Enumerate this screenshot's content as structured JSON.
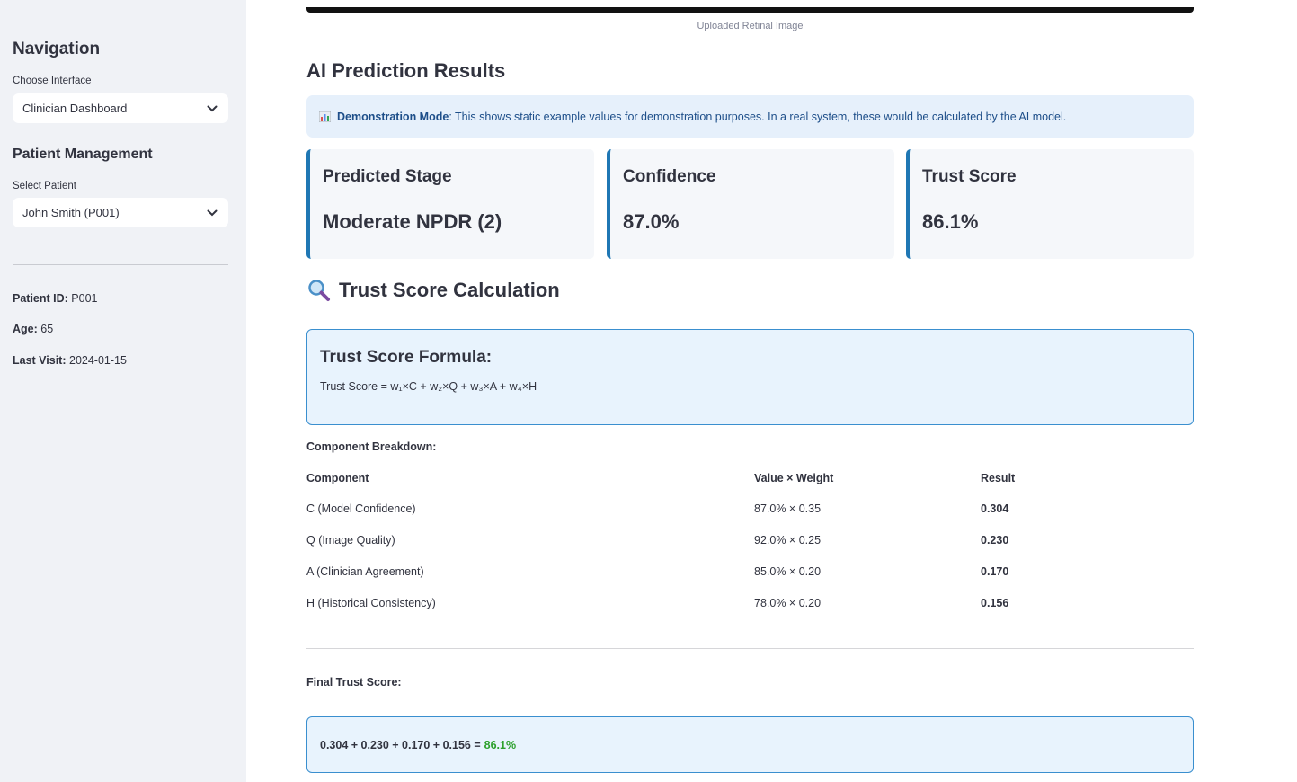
{
  "sidebar": {
    "nav_heading": "Navigation",
    "interface_label": "Choose Interface",
    "interface_value": "Clinician Dashboard",
    "patient_heading": "Patient Management",
    "patient_label": "Select Patient",
    "patient_value": "John Smith (P001)",
    "patient_id_label": "Patient ID:",
    "patient_id": "P001",
    "age_label": "Age:",
    "age": "65",
    "last_visit_label": "Last Visit:",
    "last_visit": "2024-01-15"
  },
  "main": {
    "image_caption": "Uploaded Retinal Image",
    "results_heading": "AI Prediction Results",
    "demo_bold": "Demonstration Mode",
    "demo_text": ": This shows static example values for demonstration purposes. In a real system, these would be calculated by the AI model.",
    "metrics": [
      {
        "label": "Predicted Stage",
        "value": "Moderate NPDR (2)"
      },
      {
        "label": "Confidence",
        "value": "87.0%"
      },
      {
        "label": "Trust Score",
        "value": "86.1%"
      }
    ],
    "trust_heading": "Trust Score Calculation",
    "formula_title": "Trust Score Formula:",
    "formula_text": "Trust Score = w₁×C + w₂×Q + w₃×A + w₄×H",
    "breakdown_label": "Component Breakdown:",
    "table_headers": [
      "Component",
      "Value × Weight",
      "Result"
    ],
    "table_rows": [
      [
        "C (Model Confidence)",
        "87.0% × 0.35",
        "0.304"
      ],
      [
        "Q (Image Quality)",
        "92.0% × 0.25",
        "0.230"
      ],
      [
        "A (Clinician Agreement)",
        "85.0% × 0.20",
        "0.170"
      ],
      [
        "H (Historical Consistency)",
        "78.0% × 0.20",
        "0.156"
      ]
    ],
    "final_label": "Final Trust Score:",
    "final_sum": "0.304 + 0.230 + 0.170 + 0.156 =",
    "final_value": "86.1%"
  },
  "colors": {
    "accent": "#1f77b4",
    "info_bg": "#e6f0fb",
    "success": "#2ca02c"
  },
  "icons": [
    "chevron-down-icon",
    "bar-chart-icon",
    "magnifier-icon"
  ]
}
